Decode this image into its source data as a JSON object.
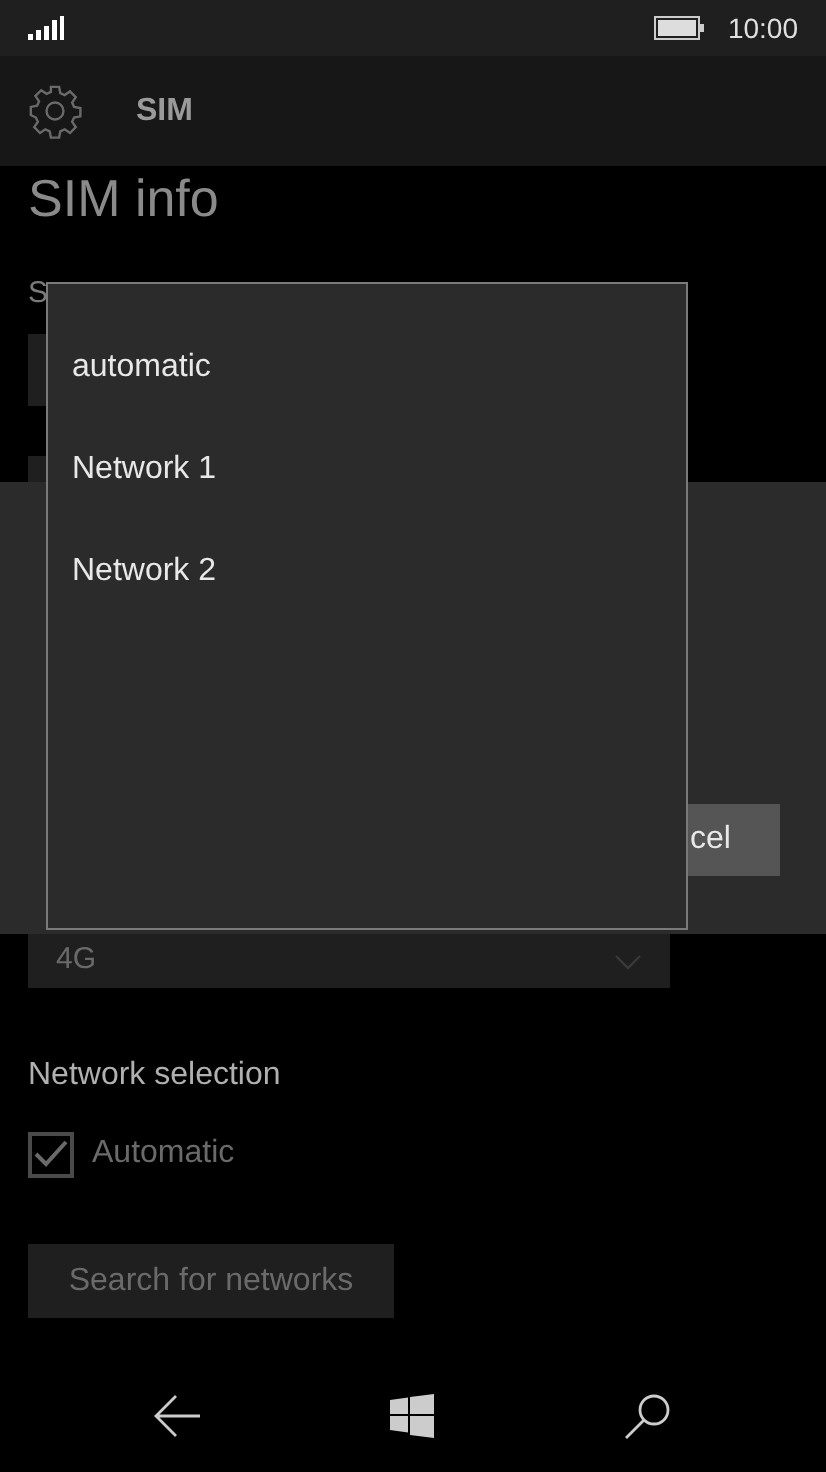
{
  "status_bar": {
    "time": "10:00"
  },
  "header": {
    "title": "SIM"
  },
  "page": {
    "title": "SIM info",
    "sim_label": "S",
    "network_type": {
      "value": "4G"
    },
    "network_selection": {
      "label": "Network selection",
      "automatic": {
        "label": "Automatic",
        "checked": true,
        "disabled": true
      }
    },
    "search_button": {
      "label": "Search for networks",
      "disabled": true
    }
  },
  "dialog": {
    "cancel_button": "cel"
  },
  "popup": {
    "items": [
      {
        "label": "automatic"
      },
      {
        "label": "Network 1"
      },
      {
        "label": "Network 2"
      }
    ]
  }
}
